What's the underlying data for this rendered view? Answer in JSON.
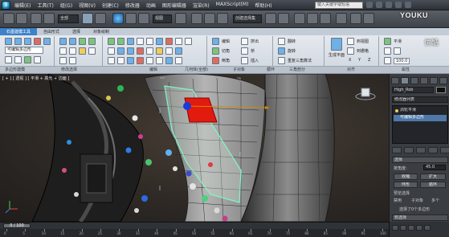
{
  "app": {
    "title": "Autodesk 3ds Max  2010    Unregistered Version    High_Rob1.max",
    "logo_glyph": "3",
    "menu": [
      "编辑(E)",
      "工具(T)",
      "组(G)",
      "视图(V)",
      "创建(C)",
      "修改器",
      "动画",
      "图形编辑器",
      "渲染(R)",
      "MAXScript(M)",
      "帮助(H)"
    ],
    "search_placeholder": "键入关键字或短语",
    "watermark": "YOUKU",
    "watermark_sub": "优酷"
  },
  "main_toolbar": {
    "selection_filter": "全部",
    "view_combo": "视图",
    "named_selection": "创建选择集"
  },
  "ribbon": {
    "tabs": [
      "石墨建模工具",
      "自由形式",
      "选择",
      "对象绘制"
    ],
    "active_tab": 0,
    "viewport_combo": "可编辑多边形",
    "group_labels": [
      "多边形建模",
      "修改选择",
      "编辑",
      "几何体(全部)",
      "子对象",
      "循环",
      "三角剖分",
      "对齐",
      "属性"
    ],
    "edit_labels": [
      "编辑",
      "挤出",
      "切角",
      "桥",
      "倒角",
      "插入",
      "焊接",
      "目标焊接",
      "塌陷",
      "切割",
      "快速切片",
      "剪切"
    ],
    "align_labels": [
      "生成平面",
      "到视图",
      "到栅格",
      "X",
      "Y",
      "Z"
    ],
    "props_labels": [
      "平滑",
      "100.0"
    ],
    "triangulate_labels": [
      "翻转",
      "旋转",
      "重复三角算法"
    ]
  },
  "viewport": {
    "label": "[ + ] [ 透视 ] [ 平滑 + 高光 + 边面 ]"
  },
  "command_panel": {
    "object_name": "High_Rob",
    "modifier_list": "修改器列表",
    "stack": [
      {
        "label": "涡轮平滑",
        "selected": false
      },
      {
        "label": "可编辑多边形",
        "selected": true
      }
    ],
    "rollout_selection": "选择",
    "rollout_soft": "软选择",
    "rows": [
      {
        "label": "按角度:",
        "value": "45.0"
      },
      {
        "label": "收缩",
        "value": "扩大"
      },
      {
        "label": "环形",
        "value": "循环"
      }
    ],
    "preview_label": "预览选择",
    "preview_options": [
      "禁用",
      "子对象",
      "多个"
    ],
    "status_line": "选择了0个多边形"
  },
  "timeline": {
    "slider": "0 / 100",
    "ticks": [
      "0",
      "5",
      "10",
      "15",
      "20",
      "25",
      "30",
      "35",
      "40",
      "45",
      "50",
      "55",
      "60",
      "65",
      "70",
      "75",
      "80",
      "85",
      "90",
      "95",
      "100"
    ]
  }
}
